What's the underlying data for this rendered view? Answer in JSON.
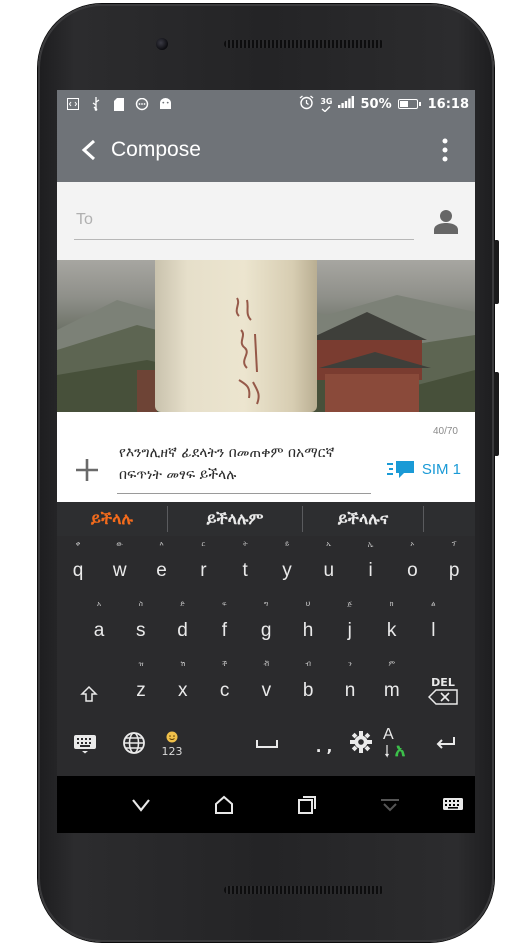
{
  "status_bar": {
    "icons_left": [
      "code-icon",
      "usb-icon",
      "sdcard-icon",
      "chat-icon",
      "android-icon"
    ],
    "icons_right": [
      "alarm-icon",
      "network-3g-icon",
      "signal-icon"
    ],
    "network": "3G",
    "battery_percent": "50%",
    "battery_level": 0.5,
    "time": "16:18"
  },
  "app_bar": {
    "title": "Compose"
  },
  "recipient": {
    "placeholder": "To"
  },
  "message": {
    "counter": "40/70",
    "text": "የእንግሊዘኛ ፊደላትን በመጠቀም በአማርኛ በፍጥነት መፃፍ ይችላሉ",
    "send_label": "SIM 1"
  },
  "suggestions": [
    "ይችላሉ",
    "ይችላሉም",
    "ይችላሉና"
  ],
  "keyboard": {
    "row1": [
      {
        "key": "q",
        "hint": "ቀ"
      },
      {
        "key": "w",
        "hint": "ው"
      },
      {
        "key": "e",
        "hint": "እ"
      },
      {
        "key": "r",
        "hint": "ር"
      },
      {
        "key": "t",
        "hint": "ት"
      },
      {
        "key": "y",
        "hint": "ይ"
      },
      {
        "key": "u",
        "hint": "ኡ"
      },
      {
        "key": "i",
        "hint": "ኢ"
      },
      {
        "key": "o",
        "hint": "ኦ"
      },
      {
        "key": "p",
        "hint": "ፕ"
      }
    ],
    "row2": [
      {
        "key": "a",
        "hint": "አ"
      },
      {
        "key": "s",
        "hint": "ስ"
      },
      {
        "key": "d",
        "hint": "ድ"
      },
      {
        "key": "f",
        "hint": "ፍ"
      },
      {
        "key": "g",
        "hint": "ግ"
      },
      {
        "key": "h",
        "hint": "ህ"
      },
      {
        "key": "j",
        "hint": "ጅ"
      },
      {
        "key": "k",
        "hint": "ክ"
      },
      {
        "key": "l",
        "hint": "ል"
      }
    ],
    "row3": [
      {
        "key": "z",
        "hint": "ዝ"
      },
      {
        "key": "x",
        "hint": "ሽ"
      },
      {
        "key": "c",
        "hint": "ች"
      },
      {
        "key": "v",
        "hint": "ቭ"
      },
      {
        "key": "b",
        "hint": "ብ"
      },
      {
        "key": "n",
        "hint": "ን"
      },
      {
        "key": "m",
        "hint": "ም"
      }
    ],
    "delete_label": "DEL",
    "numeric_label": "123",
    "punctuation_label": ". ,",
    "lang_switch_top": "A",
    "lang_switch_bottom": "አ"
  },
  "nav_bar": {
    "buttons": [
      "back-nav-icon",
      "home-nav-icon",
      "recents-nav-icon",
      "hide-keyboard-icon",
      "keyboard-switch-icon"
    ]
  },
  "colors": {
    "app_bar": "#6f7378",
    "accent_orange": "#f36b1c",
    "send_blue": "#1a9ad6",
    "keyboard_bg": "#2b2b2d"
  }
}
